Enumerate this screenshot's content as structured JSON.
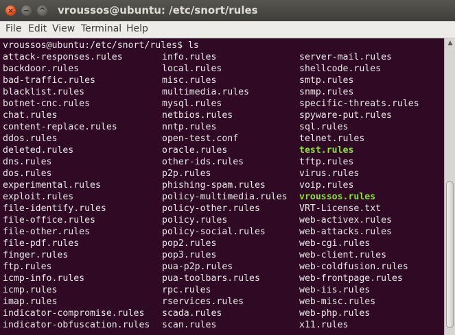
{
  "window": {
    "title": "vroussos@ubuntu: /etc/snort/rules",
    "buttons": {
      "close": "×",
      "minimize": "−",
      "maximize": "^"
    }
  },
  "menu": [
    "File",
    "Edit",
    "View",
    "Terminal",
    "Help"
  ],
  "terminal": {
    "prompt_line": "vroussos@ubuntu:/etc/snort/rules$ ls",
    "columns": [
      [
        "attack-responses.rules",
        "backdoor.rules",
        "bad-traffic.rules",
        "blacklist.rules",
        "botnet-cnc.rules",
        "chat.rules",
        "content-replace.rules",
        "ddos.rules",
        "deleted.rules",
        "dns.rules",
        "dos.rules",
        "experimental.rules",
        "exploit.rules",
        "file-identify.rules",
        "file-office.rules",
        "file-other.rules",
        "file-pdf.rules",
        "finger.rules",
        "ftp.rules",
        "icmp-info.rules",
        "icmp.rules",
        "imap.rules",
        "indicator-compromise.rules",
        "indicator-obfuscation.rules"
      ],
      [
        "info.rules",
        "local.rules",
        "misc.rules",
        "multimedia.rules",
        "mysql.rules",
        "netbios.rules",
        "nntp.rules",
        "open-test.conf",
        "oracle.rules",
        "other-ids.rules",
        "p2p.rules",
        "phishing-spam.rules",
        "policy-multimedia.rules",
        "policy-other.rules",
        "policy.rules",
        "policy-social.rules",
        "pop2.rules",
        "pop3.rules",
        "pua-p2p.rules",
        "pua-toolbars.rules",
        "rpc.rules",
        "rservices.rules",
        "scada.rules",
        "scan.rules"
      ],
      [
        "server-mail.rules",
        "shellcode.rules",
        "smtp.rules",
        "snmp.rules",
        "specific-threats.rules",
        "spyware-put.rules",
        "sql.rules",
        "telnet.rules",
        "test.rules",
        "tftp.rules",
        "virus.rules",
        "voip.rules",
        "vroussos.rules",
        "VRT-License.txt",
        "web-activex.rules",
        "web-attacks.rules",
        "web-cgi.rules",
        "web-client.rules",
        "web-coldfusion.rules",
        "web-frontpage.rules",
        "web-iis.rules",
        "web-misc.rules",
        "web-php.rules",
        "x11.rules"
      ]
    ],
    "highlighted": [
      "test.rules",
      "vroussos.rules"
    ],
    "colors": {
      "background": "#300a24",
      "text": "#e8e8e8",
      "highlight": "#8ae234"
    }
  }
}
